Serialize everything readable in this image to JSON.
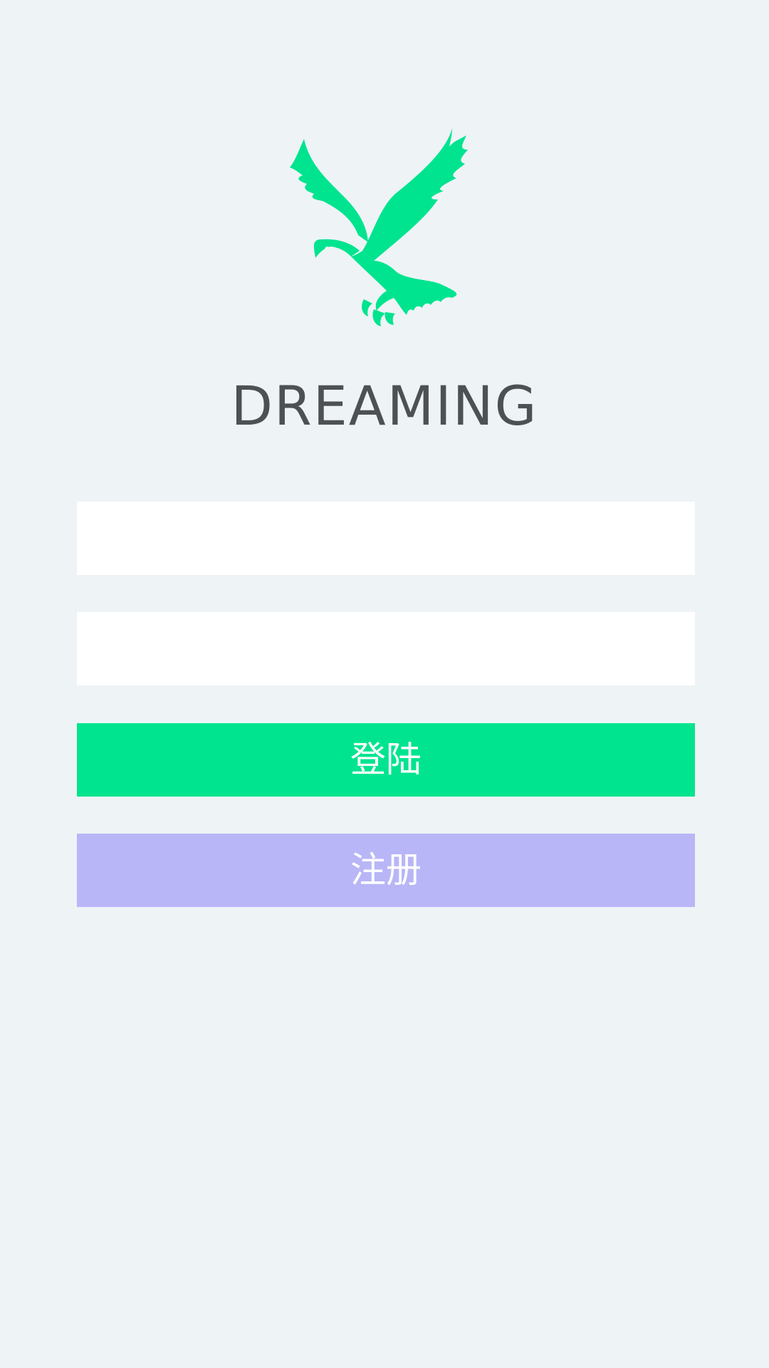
{
  "app": {
    "title": "DREAMING",
    "logo_icon": "eagle-icon"
  },
  "form": {
    "username": {
      "value": "",
      "placeholder": ""
    },
    "password": {
      "value": "",
      "placeholder": ""
    },
    "login_label": "登陆",
    "register_label": "注册"
  },
  "colors": {
    "background": "#eef3f6",
    "brand": "#00e48f",
    "title_text": "#4d5153",
    "login_button": "#00e48f",
    "register_button": "#b8b6f7",
    "button_text": "#ffffff",
    "field_background": "#ffffff"
  }
}
